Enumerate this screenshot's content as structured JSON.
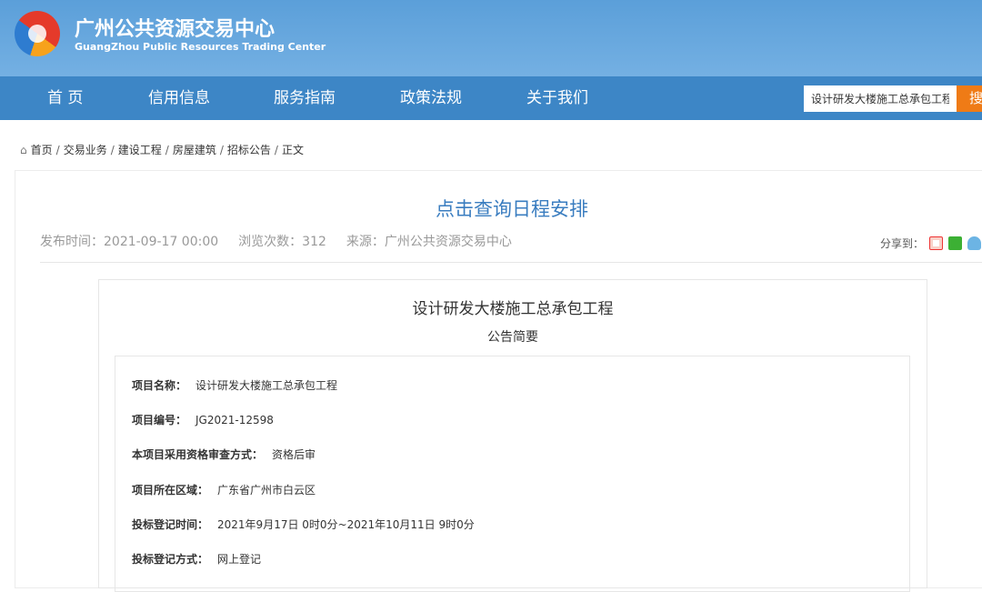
{
  "site": {
    "title_cn": "广州公共资源交易中心",
    "title_en": "GuangZhou Public Resources Trading Center"
  },
  "nav": {
    "items": [
      "首 页",
      "信用信息",
      "服务指南",
      "政策法规",
      "关于我们"
    ],
    "search_value": "设计研发大楼施工总承包工程",
    "search_button": "搜"
  },
  "breadcrumb": [
    "首页",
    "交易业务",
    "建设工程",
    "房屋建筑",
    "招标公告",
    "正文"
  ],
  "article": {
    "title": "点击查询日程安排",
    "publish": "发布时间：2021-09-17 00:00",
    "views": "浏览次数：312",
    "source": "来源：广州公共资源交易中心",
    "share_label": "分享到：",
    "share_icons": [
      "weibo-icon",
      "wechat-icon",
      "qq-icon"
    ],
    "notice_title": "设计研发大楼施工总承包工程",
    "notice_subtitle": "公告简要",
    "fields": [
      {
        "label": "项目名称：",
        "value": "设计研发大楼施工总承包工程"
      },
      {
        "label": "项目编号：",
        "value": "JG2021-12598"
      },
      {
        "label": "本项目采用资格审查方式：",
        "value": "资格后审"
      },
      {
        "label": "项目所在区域：",
        "value": "广东省广州市白云区"
      },
      {
        "label": "投标登记时间：",
        "value": "2021年9月17日 0时0分~2021年10月11日 9时0分"
      },
      {
        "label": "投标登记方式：",
        "value": "网上登记"
      }
    ]
  },
  "colors": {
    "nav": "#3d86c6",
    "accent": "#ef7b16",
    "title": "#3a7dc0"
  }
}
